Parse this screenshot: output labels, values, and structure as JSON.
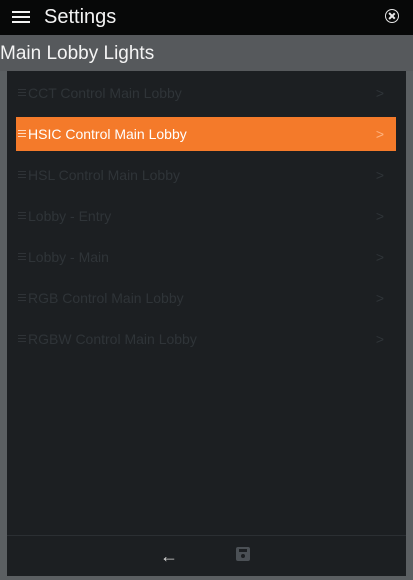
{
  "app": {
    "title": "Settings"
  },
  "section": {
    "title": "Main Lobby Lights"
  },
  "list": {
    "items": [
      {
        "label": "CCT Control Main Lobby",
        "chevron": ">"
      },
      {
        "label": "HSIC Control Main Lobby",
        "chevron": ">",
        "selected": true
      },
      {
        "label": "HSL Control Main Lobby",
        "chevron": ">"
      },
      {
        "label": "Lobby - Entry",
        "chevron": ">"
      },
      {
        "label": "Lobby - Main",
        "chevron": ">"
      },
      {
        "label": "RGB Control Main Lobby",
        "chevron": ">"
      },
      {
        "label": "RGBW Control Main Lobby",
        "chevron": ">"
      }
    ]
  },
  "footer": {
    "back_icon": "←"
  },
  "colors": {
    "accent": "#f47a2a",
    "topbar": "#070808",
    "panel": "#1c1f22",
    "header": "#56595c"
  }
}
